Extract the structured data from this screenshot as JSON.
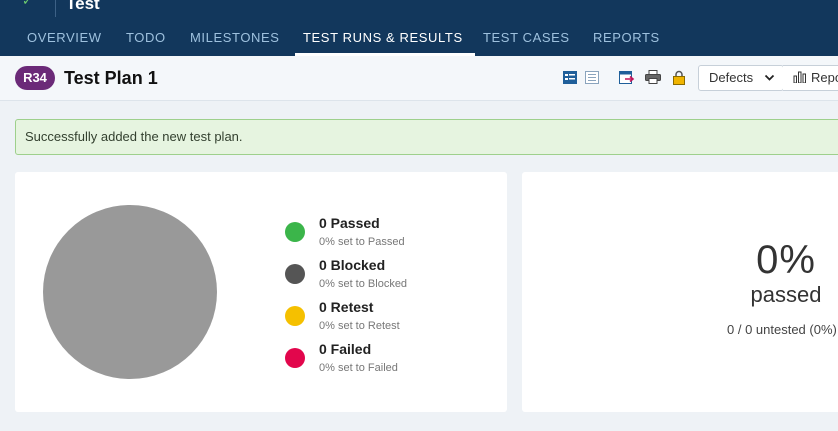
{
  "header": {
    "project_title": "Test",
    "tabs": [
      {
        "label": "OVERVIEW",
        "active": false
      },
      {
        "label": "TODO",
        "active": false
      },
      {
        "label": "MILESTONES",
        "active": false
      },
      {
        "label": "TEST RUNS & RESULTS",
        "active": true
      },
      {
        "label": "TEST CASES",
        "active": false
      },
      {
        "label": "REPORTS",
        "active": false
      }
    ]
  },
  "titlebar": {
    "badge": "R34",
    "title": "Test Plan 1",
    "defects_label": "Defects",
    "reports_label": "Reports"
  },
  "alert": {
    "message": "Successfully added the new test plan."
  },
  "stats": {
    "items": [
      {
        "label": "0 Passed",
        "sub": "0% set to Passed",
        "color": "#3bb54a"
      },
      {
        "label": "0 Blocked",
        "sub": "0% set to Blocked",
        "color": "#555555"
      },
      {
        "label": "0 Retest",
        "sub": "0% set to Retest",
        "color": "#f5c000"
      },
      {
        "label": "0 Failed",
        "sub": "0% set to Failed",
        "color": "#e2064c"
      }
    ],
    "pie_color": "#999999",
    "percent": "0%",
    "passed_word": "passed",
    "untested": "0 / 0 untested (0%)"
  },
  "colors": {
    "header_bg": "#12375c",
    "badge_bg": "#6b2a78"
  }
}
